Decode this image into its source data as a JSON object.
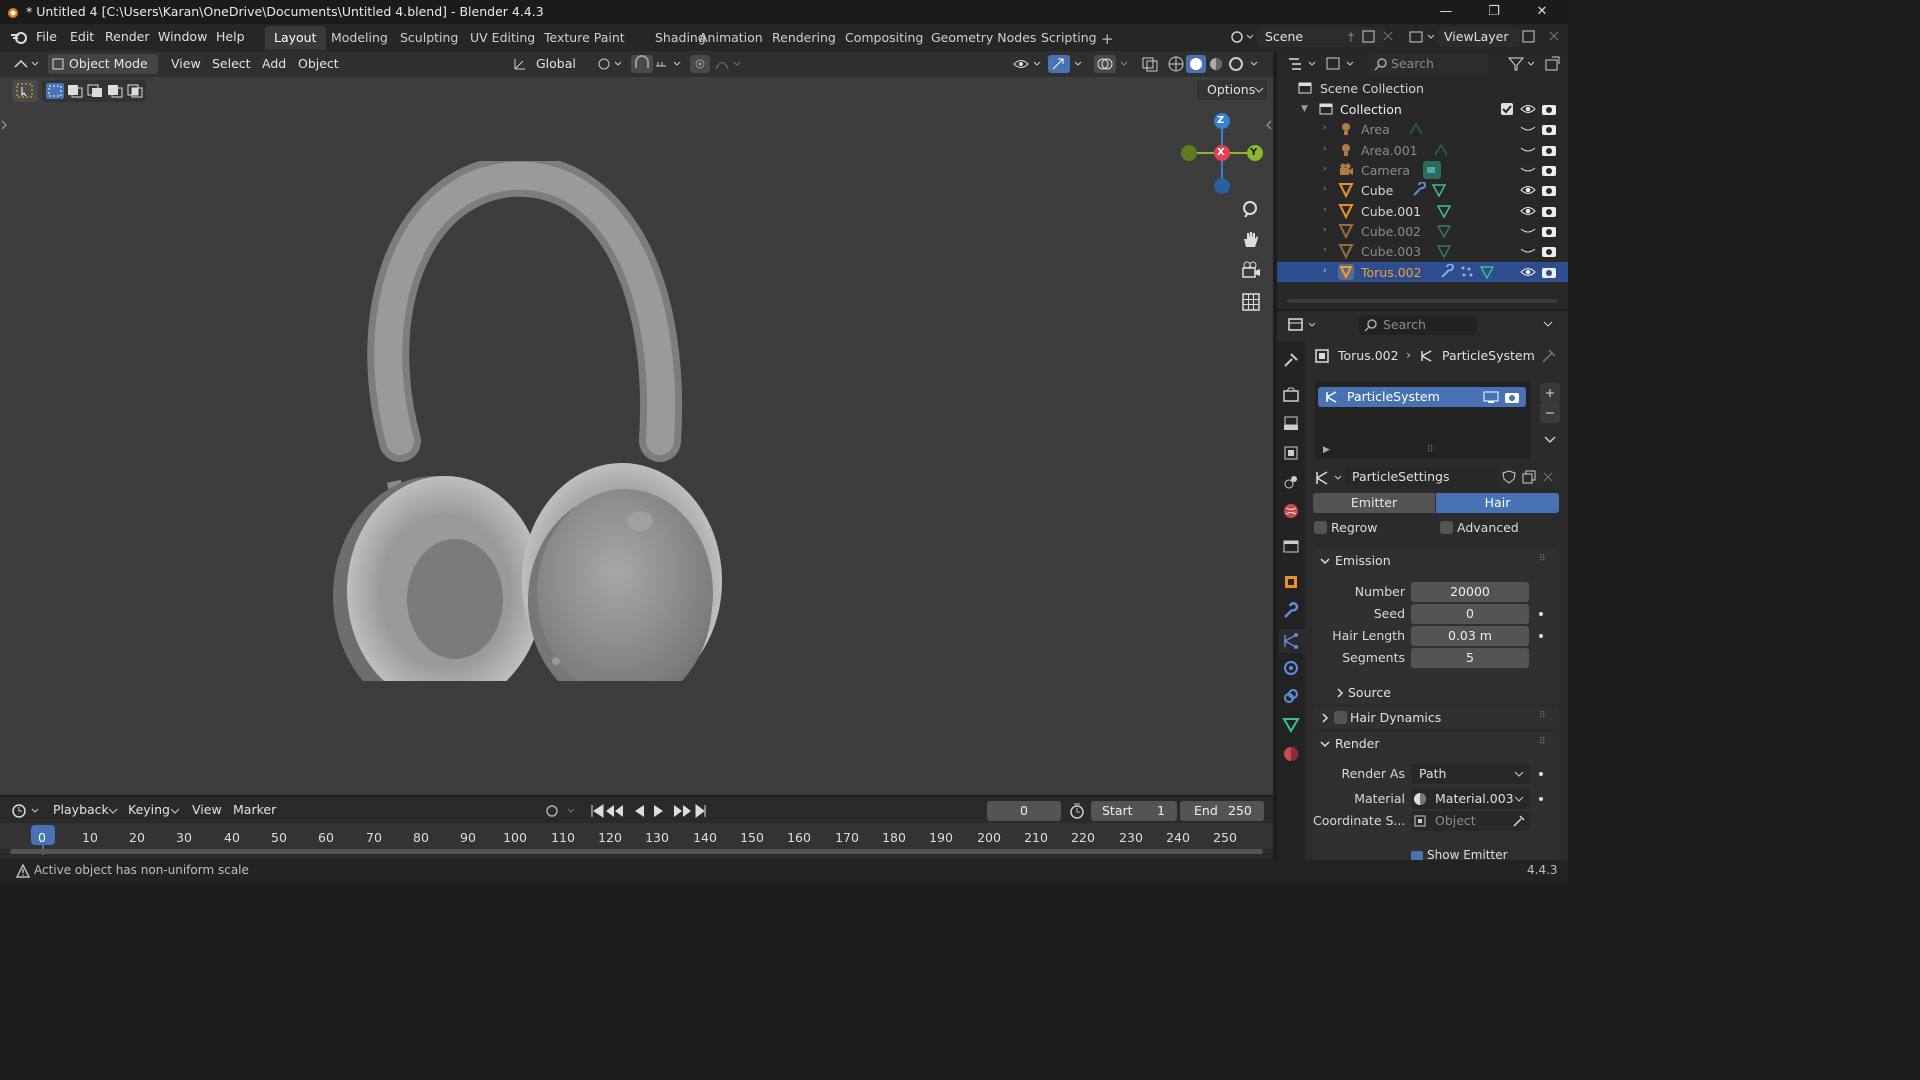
{
  "window": {
    "title": "* Untitled 4 [C:\\Users\\Karan\\OneDrive\\Documents\\Untitled 4.blend] - Blender 4.4.3",
    "minimize": "—",
    "restore": "❐",
    "close": "✕"
  },
  "menu": {
    "items": [
      "File",
      "Edit",
      "Render",
      "Window",
      "Help"
    ]
  },
  "workspaces": [
    "Layout",
    "Modeling",
    "Sculpting",
    "UV Editing",
    "Texture Paint",
    "Shading",
    "Animation",
    "Rendering",
    "Compositing",
    "Geometry Nodes",
    "Scripting"
  ],
  "workspace_add": "+",
  "scene": {
    "name": "Scene",
    "view_layer": "ViewLayer"
  },
  "viewport": {
    "mode": "Object Mode",
    "menus": [
      "View",
      "Select",
      "Add",
      "Object"
    ],
    "orientation": "Global",
    "options": "Options",
    "gizmo": {
      "z": "Z",
      "x": "X",
      "y": "Y"
    }
  },
  "outliner": {
    "search_placeholder": "Search",
    "root": "Scene Collection",
    "collection": "Collection",
    "items": [
      {
        "name": "Area",
        "visible": false,
        "kind": "light"
      },
      {
        "name": "Area.001",
        "visible": false,
        "kind": "light"
      },
      {
        "name": "Camera",
        "visible": false,
        "kind": "camera"
      },
      {
        "name": "Cube",
        "visible": true,
        "kind": "mesh"
      },
      {
        "name": "Cube.001",
        "visible": true,
        "kind": "mesh"
      },
      {
        "name": "Cube.002",
        "visible": false,
        "kind": "mesh"
      },
      {
        "name": "Cube.003",
        "visible": false,
        "kind": "mesh"
      },
      {
        "name": "Torus.002",
        "visible": true,
        "kind": "mesh",
        "selected": true
      }
    ]
  },
  "properties": {
    "search_placeholder": "Search",
    "breadcrumb_object": "Torus.002",
    "breadcrumb_sep": "›",
    "breadcrumb_system": "ParticleSystem",
    "system_name": "ParticleSystem",
    "settings_name": "ParticleSettings",
    "type_tabs": [
      "Emitter",
      "Hair"
    ],
    "regrow": "Regrow",
    "advanced": "Advanced",
    "emission": {
      "title": "Emission",
      "number_label": "Number",
      "number": "20000",
      "seed_label": "Seed",
      "seed": "0",
      "hair_length_label": "Hair Length",
      "hair_length": "0.03 m",
      "segments_label": "Segments",
      "segments": "5"
    },
    "source": "Source",
    "hair_dynamics": "Hair Dynamics",
    "render": {
      "title": "Render",
      "render_as_label": "Render As",
      "render_as": "Path",
      "material_label": "Material",
      "material": "Material.003",
      "coord_label": "Coordinate S...",
      "coord_placeholder": "Object",
      "show_emitter": "Show Emitter"
    }
  },
  "timeline": {
    "menus": [
      "Playback",
      "Keying",
      "View",
      "Marker"
    ],
    "current_frame": "0",
    "start_label": "Start",
    "start": "1",
    "end_label": "End",
    "end": "250",
    "ticks": [
      "0",
      "10",
      "20",
      "30",
      "40",
      "50",
      "60",
      "70",
      "80",
      "90",
      "100",
      "110",
      "120",
      "130",
      "140",
      "150",
      "160",
      "170",
      "180",
      "190",
      "200",
      "210",
      "220",
      "230",
      "240",
      "250"
    ]
  },
  "status": {
    "message": "Active object has non-uniform scale",
    "version": "4.4.3"
  },
  "colors": {
    "accent": "#4772b3",
    "selected_row": "#2c4d8e",
    "active_orange": "#f0a030",
    "gizmo_x": "#e53e55",
    "gizmo_y": "#8ab630",
    "gizmo_z": "#3b7fd4"
  }
}
